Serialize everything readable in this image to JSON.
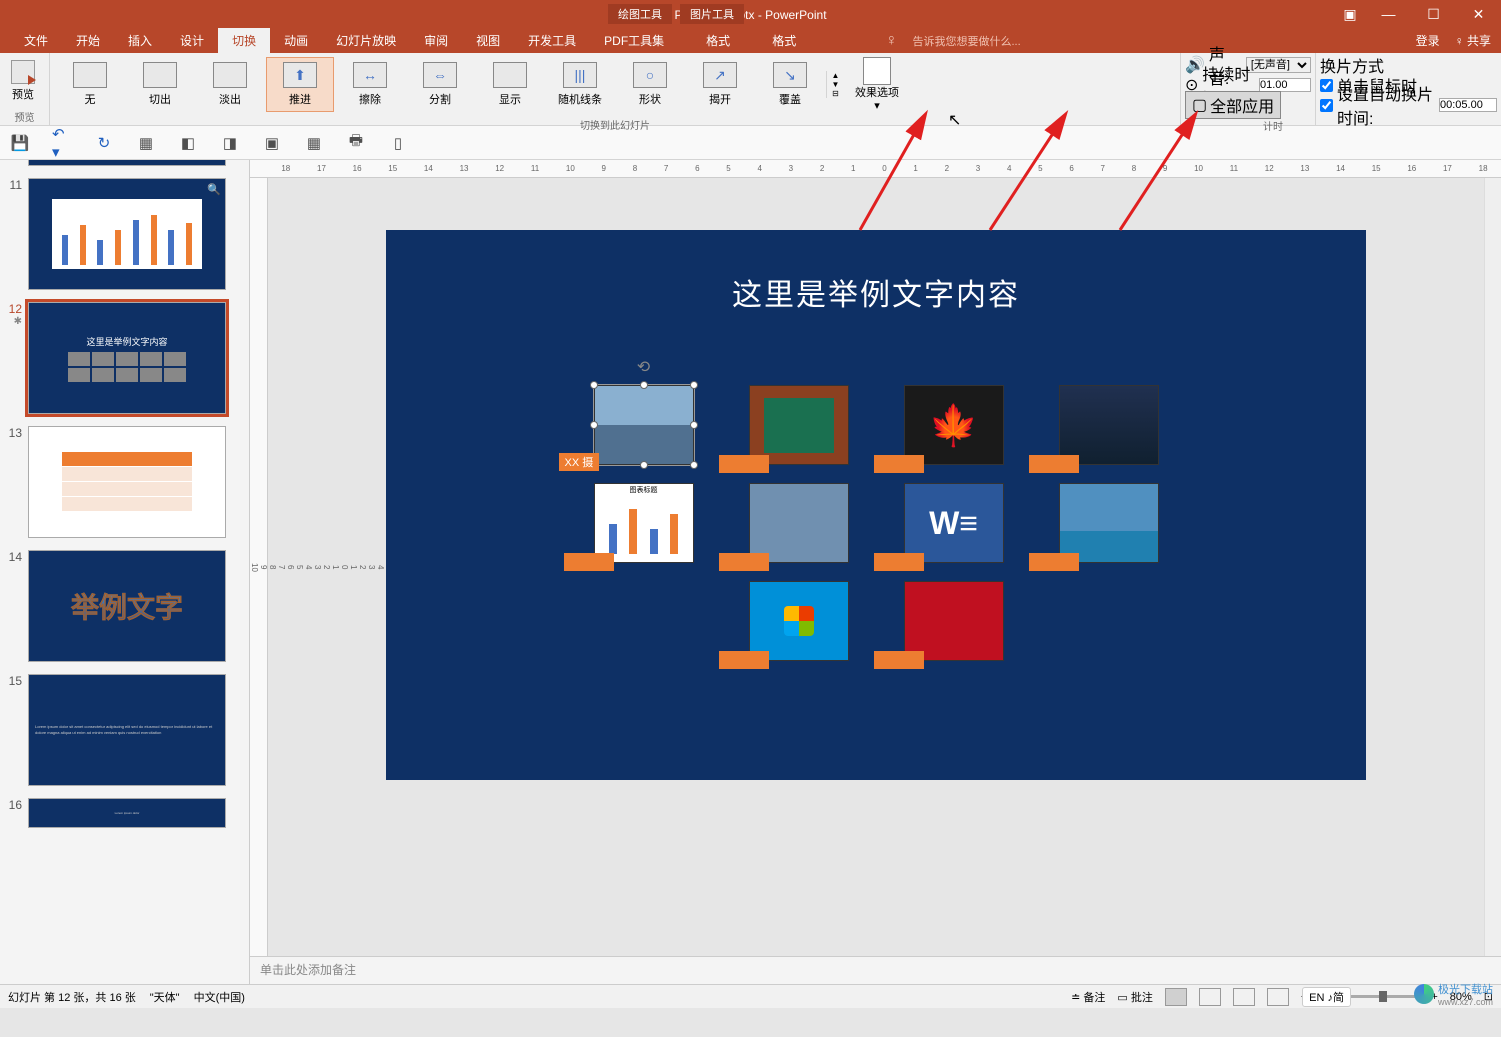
{
  "titlebar": {
    "filename": "PPT教程2.pptx - PowerPoint",
    "ctx_draw": "绘图工具",
    "ctx_pic": "图片工具"
  },
  "menu": {
    "file": "文件",
    "home": "开始",
    "insert": "插入",
    "design": "设计",
    "transitions": "切换",
    "animations": "动画",
    "slideshow": "幻灯片放映",
    "review": "审阅",
    "view": "视图",
    "dev": "开发工具",
    "pdf": "PDF工具集",
    "format1": "格式",
    "format2": "格式",
    "tellme": "告诉我您想要做什么...",
    "login": "登录",
    "share": "共享"
  },
  "ribbon": {
    "preview": "预览",
    "preview_group": "预览",
    "trans_none": "无",
    "trans_cut": "切出",
    "trans_fade": "淡出",
    "trans_push": "推进",
    "trans_wipe": "擦除",
    "trans_split": "分割",
    "trans_reveal": "显示",
    "trans_random": "随机线条",
    "trans_shape": "形状",
    "trans_uncover": "揭开",
    "trans_cover": "覆盖",
    "transitions_group": "切换到此幻灯片",
    "effect_options": "效果选项",
    "sound_label": "声音:",
    "sound_none": "[无声音]",
    "duration_label": "持续时间:",
    "duration_value": "01.00",
    "apply_all": "全部应用",
    "timing_group": "计时",
    "advance_label": "换片方式",
    "on_click": "单击鼠标时",
    "after": "设置自动换片时间:",
    "after_value": "00:05.00"
  },
  "thumbs": {
    "n11": "11",
    "n12": "12",
    "n13": "13",
    "n14": "14",
    "n15": "15",
    "n16": "16",
    "title12": "这里是举例文字内容",
    "art_text": "举例文字"
  },
  "slide": {
    "title": "这里是举例文字内容",
    "xx_label": "XX 摄",
    "chart_title": "图表标题"
  },
  "notes": {
    "placeholder": "单击此处添加备注"
  },
  "status": {
    "slide_info": "幻灯片 第 12 张，共 16 张",
    "theme": "\"天体\"",
    "lang": "中文(中国)",
    "notes_btn": "备注",
    "comments_btn": "批注",
    "zoom": "80%"
  },
  "watermark": {
    "text": "极光下载站",
    "url": "www.xz7.com"
  },
  "lang_indicator": "EN ♪简"
}
